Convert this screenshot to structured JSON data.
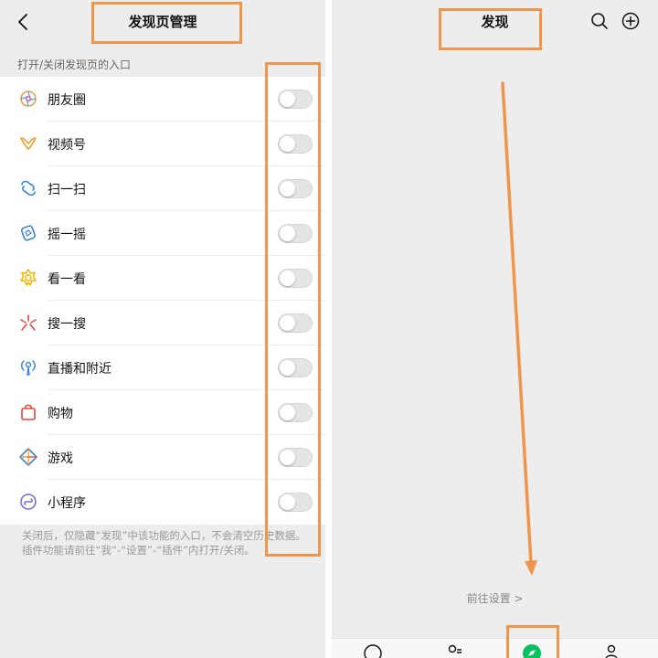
{
  "left_screen": {
    "title": "发现页管理",
    "back_icon": "chevron-left-icon",
    "section_header": "打开/关闭发现页的入口",
    "items": [
      {
        "label": "朋友圈",
        "icon": "moments-icon",
        "enabled": false
      },
      {
        "label": "视频号",
        "icon": "channels-icon",
        "enabled": false
      },
      {
        "label": "扫一扫",
        "icon": "scan-icon",
        "enabled": false
      },
      {
        "label": "摇一摇",
        "icon": "shake-icon",
        "enabled": false
      },
      {
        "label": "看一看",
        "icon": "top-stories-icon",
        "enabled": false
      },
      {
        "label": "搜一搜",
        "icon": "search-sparkle-icon",
        "enabled": false
      },
      {
        "label": "直播和附近",
        "icon": "live-nearby-icon",
        "enabled": false
      },
      {
        "label": "购物",
        "icon": "shopping-bag-icon",
        "enabled": false
      },
      {
        "label": "游戏",
        "icon": "games-icon",
        "enabled": false
      },
      {
        "label": "小程序",
        "icon": "mini-programs-icon",
        "enabled": false
      }
    ],
    "footnote": "关闭后，仅隐藏“发现”中该功能的入口，不会清空历史数据。插件功能请前往“我”-“设置”-“插件”内打开/关闭。"
  },
  "right_screen": {
    "title": "发现",
    "search_icon": "search-icon",
    "add_icon": "plus-circle-icon",
    "goto_settings_label": "前往设置 >",
    "tabbar_icons": [
      "chat-icon",
      "contacts-icon",
      "discover-compass-icon",
      "me-icon"
    ]
  },
  "colors": {
    "page_background": "#ededed",
    "card_background": "#ffffff",
    "annotation": "#f0954a",
    "discover_active": "#07c160",
    "toggle_off": "#e4e4e4"
  }
}
